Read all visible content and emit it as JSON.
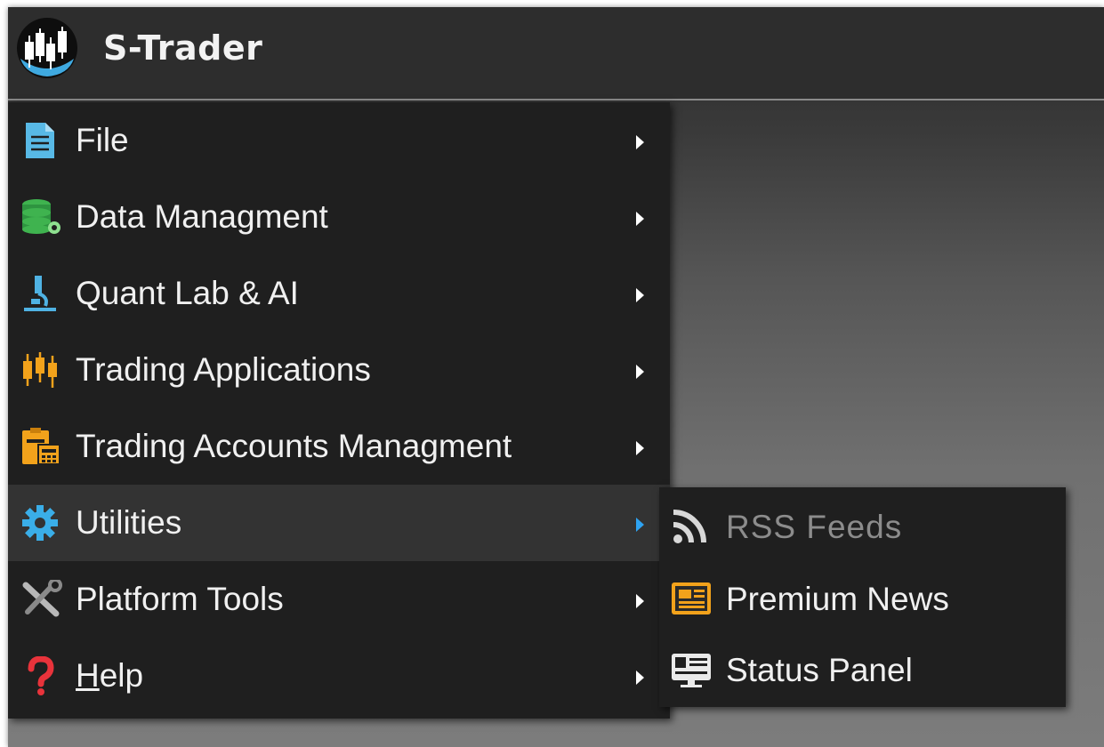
{
  "app": {
    "title": "S-Trader",
    "logo_icon": "candlestick-logo-icon"
  },
  "menu": {
    "items": [
      {
        "label": "File",
        "icon": "document-icon",
        "has_submenu": true
      },
      {
        "label": "Data Managment",
        "icon": "database-gear-icon",
        "has_submenu": true
      },
      {
        "label": "Quant Lab & AI",
        "icon": "microscope-icon",
        "has_submenu": true
      },
      {
        "label": "Trading Applications",
        "icon": "candlestick-icon",
        "has_submenu": true
      },
      {
        "label": "Trading Accounts Managment",
        "icon": "clipboard-calculator-icon",
        "has_submenu": true
      },
      {
        "label": "Utilities",
        "icon": "gear-icon",
        "has_submenu": true,
        "active": true
      },
      {
        "label": "Platform Tools",
        "icon": "wrench-screwdriver-icon",
        "has_submenu": true
      },
      {
        "label": "Help",
        "icon": "question-mark-icon",
        "has_submenu": true
      }
    ]
  },
  "submenu": {
    "parent": "Utilities",
    "items": [
      {
        "label": "RSS Feeds",
        "icon": "rss-icon",
        "enabled": false
      },
      {
        "label": "Premium News",
        "icon": "newspaper-icon",
        "enabled": true
      },
      {
        "label": "Status Panel",
        "icon": "status-panel-icon",
        "enabled": true
      }
    ]
  },
  "colors": {
    "menu_bg": "#1f1f1f",
    "active_bg": "#333333",
    "accent": "#2ea3f2",
    "icon_orange": "#f2a21b",
    "icon_green": "#3fb34f",
    "icon_red": "#e8333b"
  }
}
